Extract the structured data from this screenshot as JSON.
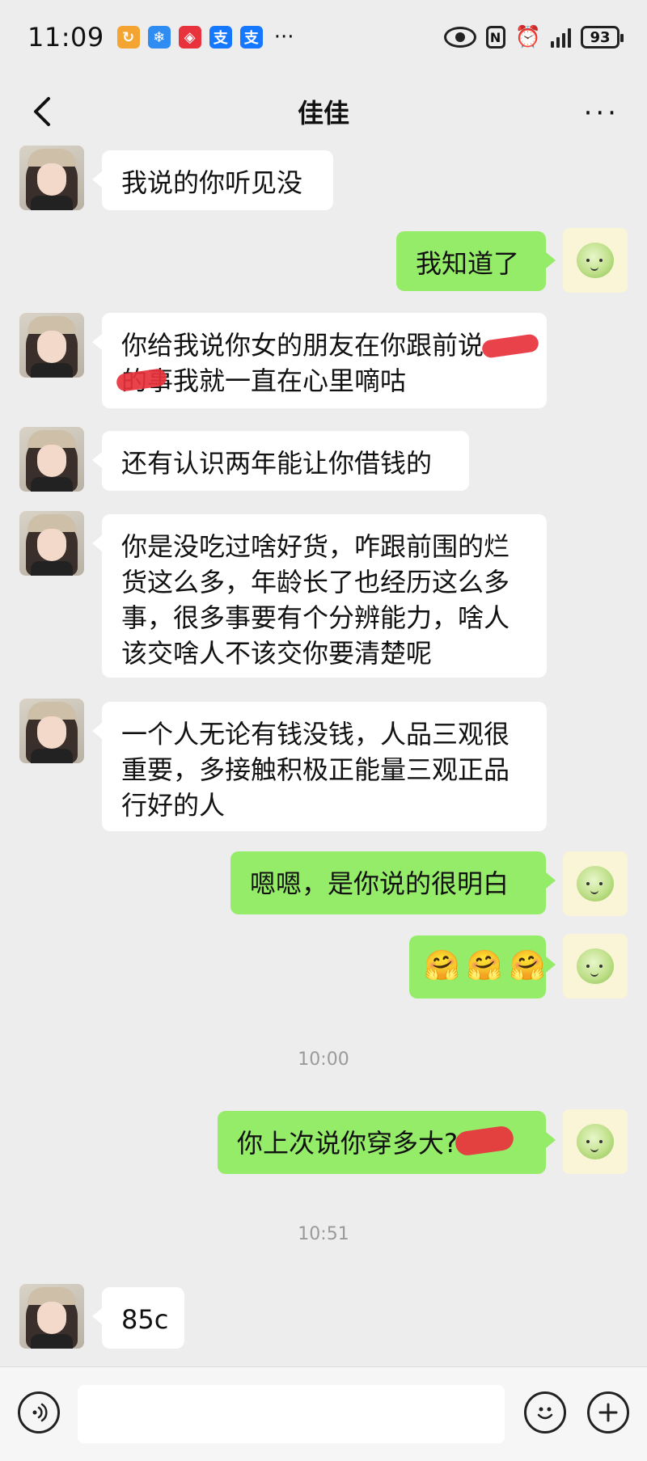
{
  "status_bar": {
    "time": "11:09",
    "more_indicator": "···",
    "battery": "93",
    "app_icons": [
      "app-icon-orange",
      "app-icon-blue-snow",
      "app-icon-red",
      "alipay-icon",
      "alipay-icon"
    ]
  },
  "header": {
    "title": "佳佳",
    "more": "···"
  },
  "messages": [
    {
      "side": "left",
      "text": "我说的你听见没"
    },
    {
      "side": "right",
      "text": "我知道了"
    },
    {
      "side": "left",
      "lines": [
        "你给我说你女的朋友在你跟前说",
        "的事我就一直在心里嘀咕"
      ]
    },
    {
      "side": "left",
      "text": "还有认识两年能让你借钱的"
    },
    {
      "side": "left",
      "lines": [
        "你是没吃过啥好货，咋跟前围的烂",
        "货这么多，年龄长了也经历这么多",
        "事，很多事要有个分辨能力，啥人",
        "该交啥人不该交你要清楚呢"
      ]
    },
    {
      "side": "left",
      "lines": [
        "一个人无论有钱没钱，人品三观很",
        "重要，多接触积极正能量三观正品",
        "行好的人"
      ]
    },
    {
      "side": "right",
      "text": "嗯嗯，是你说的很明白"
    },
    {
      "side": "right",
      "emoji": [
        "🤗",
        "🤗",
        "🤗"
      ]
    },
    {
      "side": "right",
      "text": "你上次说你穿多大"
    }
  ],
  "timestamps": [
    "10:00",
    "10:51"
  ],
  "last_message": {
    "side": "left",
    "text": "85c"
  },
  "input_bar": {
    "placeholder": ""
  },
  "colors": {
    "background": "#ededed",
    "bubble_right": "#95ec69",
    "bubble_left": "#ffffff",
    "redaction": "#e8323c"
  }
}
